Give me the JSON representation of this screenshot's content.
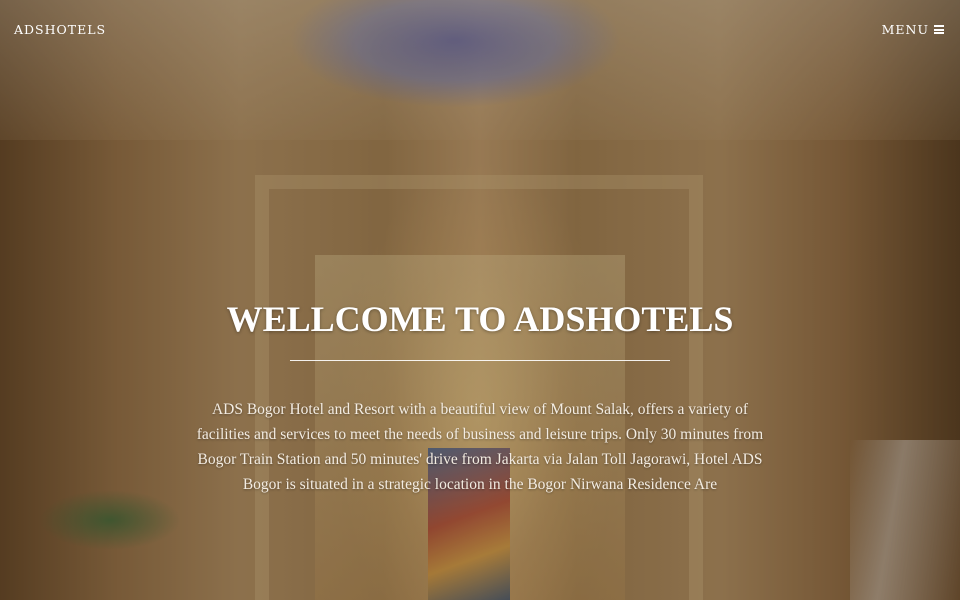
{
  "nav": {
    "brand": "ADSHOTELS",
    "menu_label": "MENU",
    "menu_icon": "hamburger-icon"
  },
  "hero": {
    "title": "WELLCOME TO ADSHOTELS",
    "description": "ADS Bogor Hotel and Resort with a beautiful view of Mount Salak, offers a variety of facilities and services to meet the needs of business and leisure trips. Only 30 minutes from Bogor Train Station and 50 minutes' drive from Jakarta via Jalan Toll Jagorawi, Hotel ADS Bogor is situated in a strategic location in the Bogor Nirwana Residence Are",
    "background": "hotel-lobby-photo"
  },
  "colors": {
    "text": "#ffffff",
    "overlay": "#1e140a"
  }
}
